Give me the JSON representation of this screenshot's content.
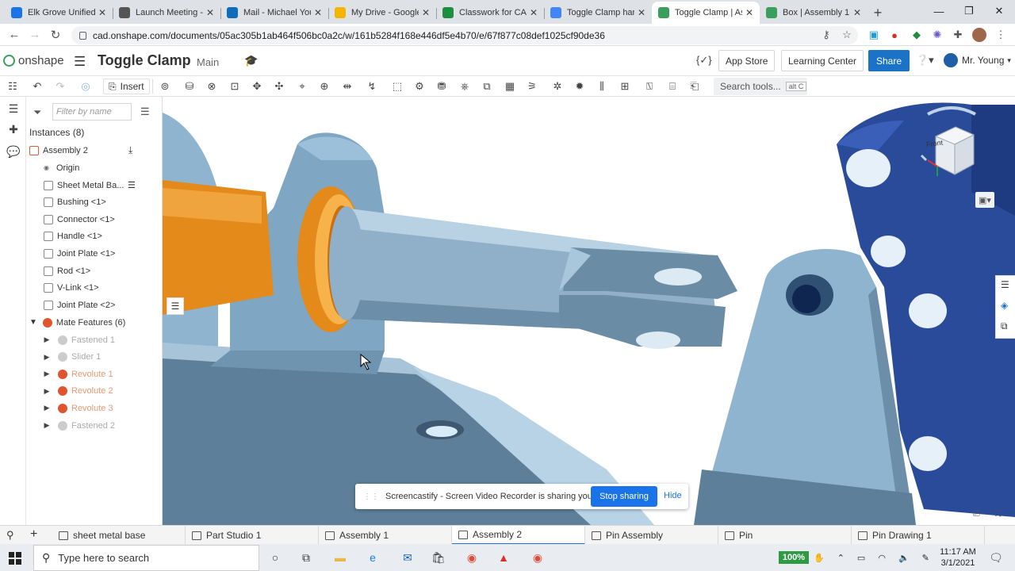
{
  "browser": {
    "tabs": [
      {
        "title": "Elk Grove Unified",
        "color": "#1a73e8",
        "active": false
      },
      {
        "title": "Launch Meeting - Zoom",
        "color": "#555555",
        "active": false
      },
      {
        "title": "Mail - Michael Young",
        "color": "#0f6cbd",
        "active": false
      },
      {
        "title": "My Drive - Google Drive",
        "color": "#f5b400",
        "active": false
      },
      {
        "title": "Classwork for CAD",
        "color": "#1e8e3e",
        "active": false
      },
      {
        "title": "Toggle Clamp hardware",
        "color": "#4285f4",
        "active": false
      },
      {
        "title": "Toggle Clamp | Assembly",
        "color": "#3b9e5c",
        "active": true
      },
      {
        "title": "Box | Assembly 1",
        "color": "#3b9e5c",
        "active": false
      }
    ],
    "url": "cad.onshape.com/documents/05ac305b1ab464f506bc0a2c/w/161b5284f168e446df5e4b70/e/67f877c08def1025cf90de36"
  },
  "app": {
    "logo_text": "onshape",
    "doc_title": "Toggle Clamp",
    "branch": "Main",
    "variable_btn": "{✓}",
    "app_store": "App Store",
    "learning_center": "Learning Center",
    "share": "Share",
    "user": "Mr. Young"
  },
  "toolbar": {
    "insert": "Insert",
    "search_tools": "Search tools...",
    "search_shortcut": "alt C"
  },
  "panel": {
    "filter_placeholder": "Filter by name",
    "instances_label": "Instances (8)",
    "assembly": "Assembly 2",
    "origin": "Origin",
    "instances": [
      "Sheet Metal Ba...",
      "Bushing <1>",
      "Connector <1>",
      "Handle <1>",
      "Joint Plate <1>",
      "Rod <1>",
      "V-Link <1>",
      "Joint Plate <2>"
    ],
    "mates_label": "Mate Features (6)",
    "mates": [
      {
        "name": "Fastened 1",
        "type": "fastened"
      },
      {
        "name": "Slider 1",
        "type": "slider"
      },
      {
        "name": "Revolute 1",
        "type": "revolute"
      },
      {
        "name": "Revolute 2",
        "type": "revolute"
      },
      {
        "name": "Revolute 3",
        "type": "revolute"
      },
      {
        "name": "Fastened 2",
        "type": "fastened"
      }
    ]
  },
  "viewcube": {
    "face": "Front"
  },
  "screencastify": {
    "message": "Screencastify - Screen Video Recorder is sharing your screen.",
    "stop": "Stop sharing",
    "hide": "Hide"
  },
  "bottom_tabs": [
    "sheet metal base",
    "Part Studio 1",
    "Assembly 1",
    "Assembly 2",
    "Pin Assembly",
    "Pin",
    "Pin Drawing 1"
  ],
  "bottom_active": "Assembly 2",
  "taskbar": {
    "search": "Type here to search",
    "zoom": "100%",
    "time": "11:17 AM",
    "date": "3/1/2021"
  },
  "colors": {
    "part_light": "#8fb4cf",
    "part_dark": "#5d7f99",
    "bushing": "#e38a1a",
    "handle": "#2a4a9a",
    "accent": "#1a73c7"
  }
}
